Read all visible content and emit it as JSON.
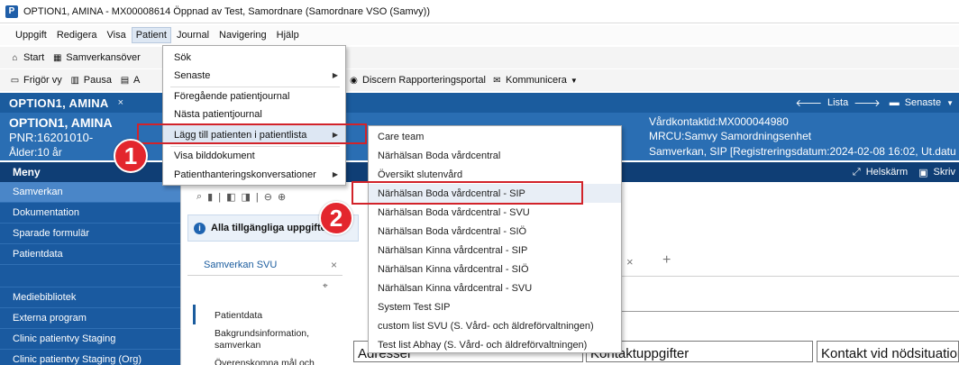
{
  "window": {
    "title": "OPTION1, AMINA - MX00008614 Öppnad av Test, Samordnare (Samordnare VSO (Samvy))",
    "app_icon": "P"
  },
  "menubar": [
    "Uppgift",
    "Redigera",
    "Visa",
    "Patient",
    "Journal",
    "Navigering",
    "Hjälp"
  ],
  "toolbar1": {
    "start": "Start",
    "samverkan": "Samverkansöver"
  },
  "toolbar2": {
    "frigor": "Frigör vy",
    "pausa": "Pausa",
    "a": "A",
    "discern": "Discern Rapporteringsportal",
    "kommunicera": "Kommunicera"
  },
  "patient_bar": {
    "name": "OPTION1, AMINA",
    "lista": "Lista",
    "senaste": "Senaste"
  },
  "patient_info": {
    "name": "OPTION1, AMINA",
    "pnr": "PNR:16201010-",
    "age": "Ålder:10 år",
    "vardkontakt": "Vårdkontaktid:MX000044980",
    "mrcu": "MRCU:Samvy Samordningsenhet",
    "samverkan": "Samverkan, SIP [Registreringsdatum:2024-02-08 16:02, Ut.datu"
  },
  "menu_header": {
    "label": "Meny",
    "helskarm": "Helskärm",
    "skriv": "Skriv"
  },
  "sidebar": [
    "Samverkan",
    "Dokumentation",
    "Sparade formulär",
    "Patientdata",
    "",
    "Mediebibliotek",
    "Externa program",
    "Clinic patientvy Staging",
    "Clinic patientvy Staging (Org)"
  ],
  "content": {
    "alert": "Alla tillgängliga uppgifter",
    "tab": "Samverkan SVU",
    "nav": [
      "Patientdata",
      "Bakgrundsinformation,",
      "samverkan",
      "Överenskomna mål och"
    ],
    "sections": [
      "Adresser",
      "Kontaktuppgifter",
      "Kontakt vid nödsituation"
    ]
  },
  "patient_menu": {
    "items": [
      "Sök",
      "Senaste",
      "Föregående patientjournal",
      "Nästa patientjournal",
      "Lägg till patienten i patientlista",
      "Visa bilddokument",
      "Patienthanteringskonversationer"
    ]
  },
  "submenu": {
    "items": [
      "Care team",
      "Närhälsan Boda vårdcentral",
      "Översikt slutenvård",
      "Närhälsan Boda vårdcentral - SIP",
      "Närhälsan Boda vårdcentral - SVU",
      "Närhälsan Boda vårdcentral - SIÖ",
      "Närhälsan Kinna vårdcentral - SIP",
      "Närhälsan Kinna vårdcentral - SIÖ",
      "Närhälsan Kinna vårdcentral - SVU",
      "System Test SIP",
      "custom list SVU  (S. Vård- och äldreförvaltningen)",
      "Test list Abhay  (S. Vård- och äldreförvaltningen)"
    ]
  },
  "callouts": {
    "one": "1",
    "two": "2"
  },
  "colors": {
    "header": "#1b5c9e",
    "info": "#2a6eb3",
    "menu": "#0f3e75",
    "sidebar": "#1a5aa0",
    "callout": "#e3262d"
  }
}
